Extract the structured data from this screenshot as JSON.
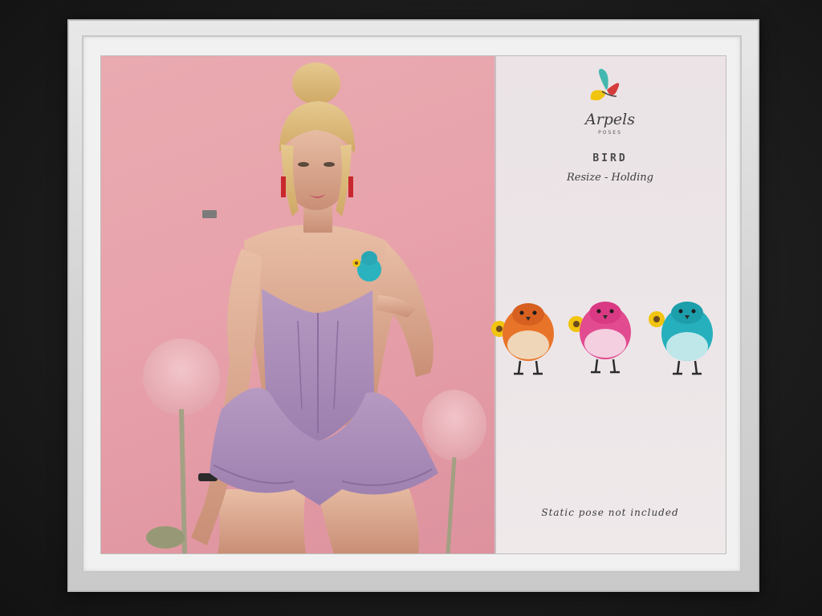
{
  "poster": {
    "brand": "Arpels",
    "brand_sub": "POSES",
    "title": "BIRD",
    "subtitle": "Resize - Holding",
    "footnote": "Static pose not included"
  },
  "birds": [
    {
      "name": "orange-bird",
      "body": "#e8742a",
      "belly": "#f0d6b8",
      "head": "#d75f1f"
    },
    {
      "name": "pink-bird",
      "body": "#e24b90",
      "belly": "#f3cfe0",
      "head": "#d93a83"
    },
    {
      "name": "teal-bird",
      "body": "#26b0bd",
      "belly": "#bfe7ea",
      "head": "#1d9eab"
    }
  ],
  "icons": [
    "butterfly-logo-icon",
    "sunflower-icon"
  ],
  "colors": {
    "photo_background": "#e8a2ab",
    "panel_background": "#ece6e8",
    "frame": "#d6d6d6",
    "outfit": "#a987b5"
  }
}
